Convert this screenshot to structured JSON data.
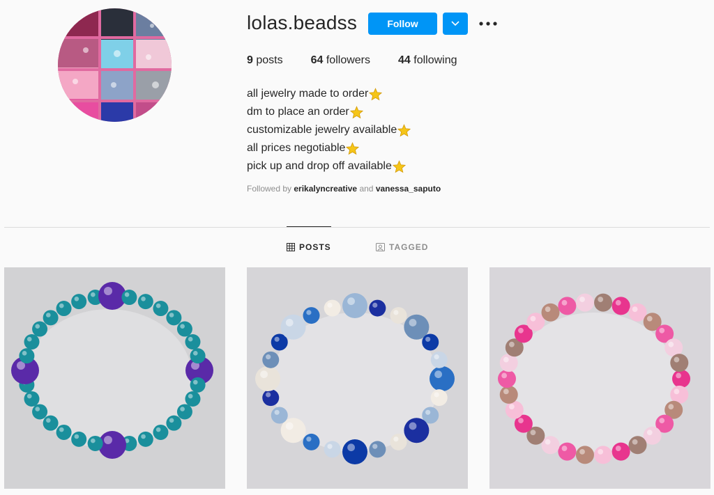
{
  "profile": {
    "username": "lolas.beadss",
    "follow_label": "Follow",
    "stats": {
      "posts_count": "9",
      "posts_label": "posts",
      "followers_count": "64",
      "followers_label": "followers",
      "following_count": "44",
      "following_label": "following"
    },
    "bio": [
      "all jewelry made to order",
      "dm to place an order",
      "customizable jewelry available",
      "all prices negotiable",
      "pick up and drop off available"
    ],
    "followed_by_prefix": "Followed by",
    "followed_by_user1": "erikalyncreative",
    "followed_by_and": "and",
    "followed_by_user2": "vanessa_saputo"
  },
  "tabs": {
    "posts": "POSTS",
    "tagged": "TAGGED"
  },
  "colors": {
    "accent": "#0095f6",
    "star": "#f5c518"
  },
  "icons": {
    "bio_emoji": "star-icon",
    "more": "more-options-icon",
    "dropdown": "chevron-down-icon",
    "posts_tab": "grid-icon",
    "tagged_tab": "tagged-icon"
  }
}
